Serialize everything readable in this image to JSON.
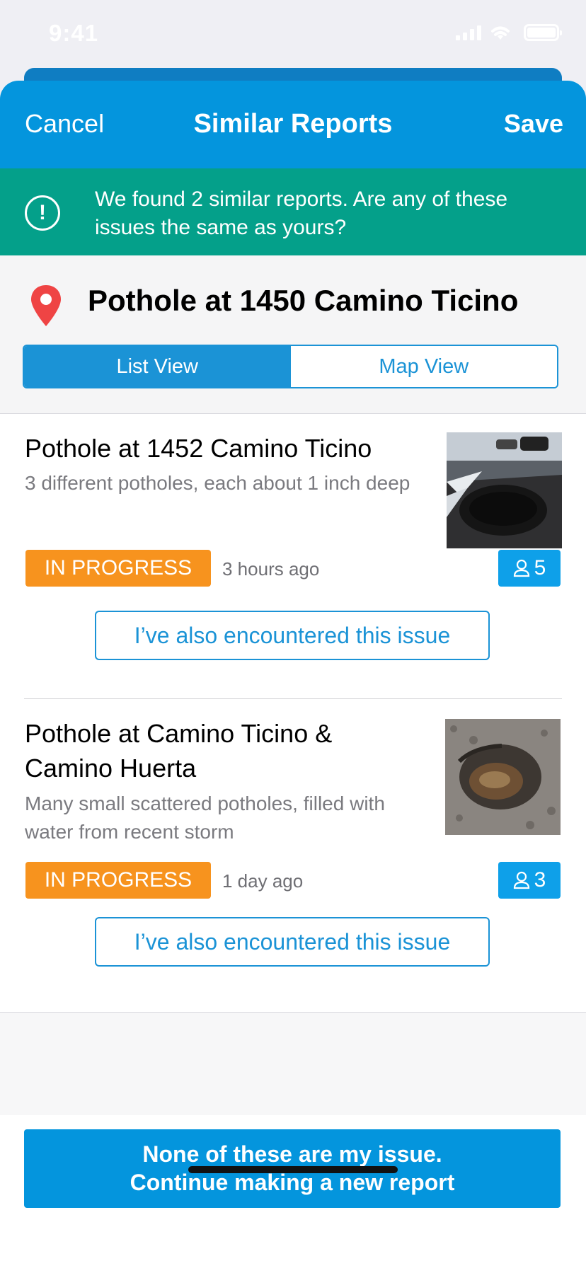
{
  "status_bar": {
    "time": "9:41"
  },
  "nav": {
    "cancel": "Cancel",
    "title": "Similar Reports",
    "save": "Save"
  },
  "banner": {
    "icon": "!",
    "text": "We found 2 similar reports. Are any of these issues the same as yours?"
  },
  "location": {
    "title": "Pothole at 1450 Camino Ticino"
  },
  "view_toggle": {
    "list": "List View",
    "map": "Map View",
    "selected": "List View"
  },
  "reports": [
    {
      "title": "Pothole at 1452 Camino Ticino",
      "description": "3 different potholes, each about 1 inch deep",
      "status": "IN PROGRESS",
      "time_ago": "3 hours ago",
      "count": "5",
      "action": "I’ve also encountered this issue"
    },
    {
      "title": "Pothole at Camino Ticino & Camino Huerta",
      "description": "Many small scattered potholes, filled with water from recent storm",
      "status": "IN PROGRESS",
      "time_ago": "1 day ago",
      "count": "3",
      "action": "I’ve also encountered this issue"
    }
  ],
  "footer": {
    "cta_line1": "None of these are my issue.",
    "cta_line2": "Continue making a new report"
  },
  "colors": {
    "primary": "#0495dd",
    "banner": "#04a08a",
    "status": "#f7931e",
    "pin": "#ef4444"
  }
}
